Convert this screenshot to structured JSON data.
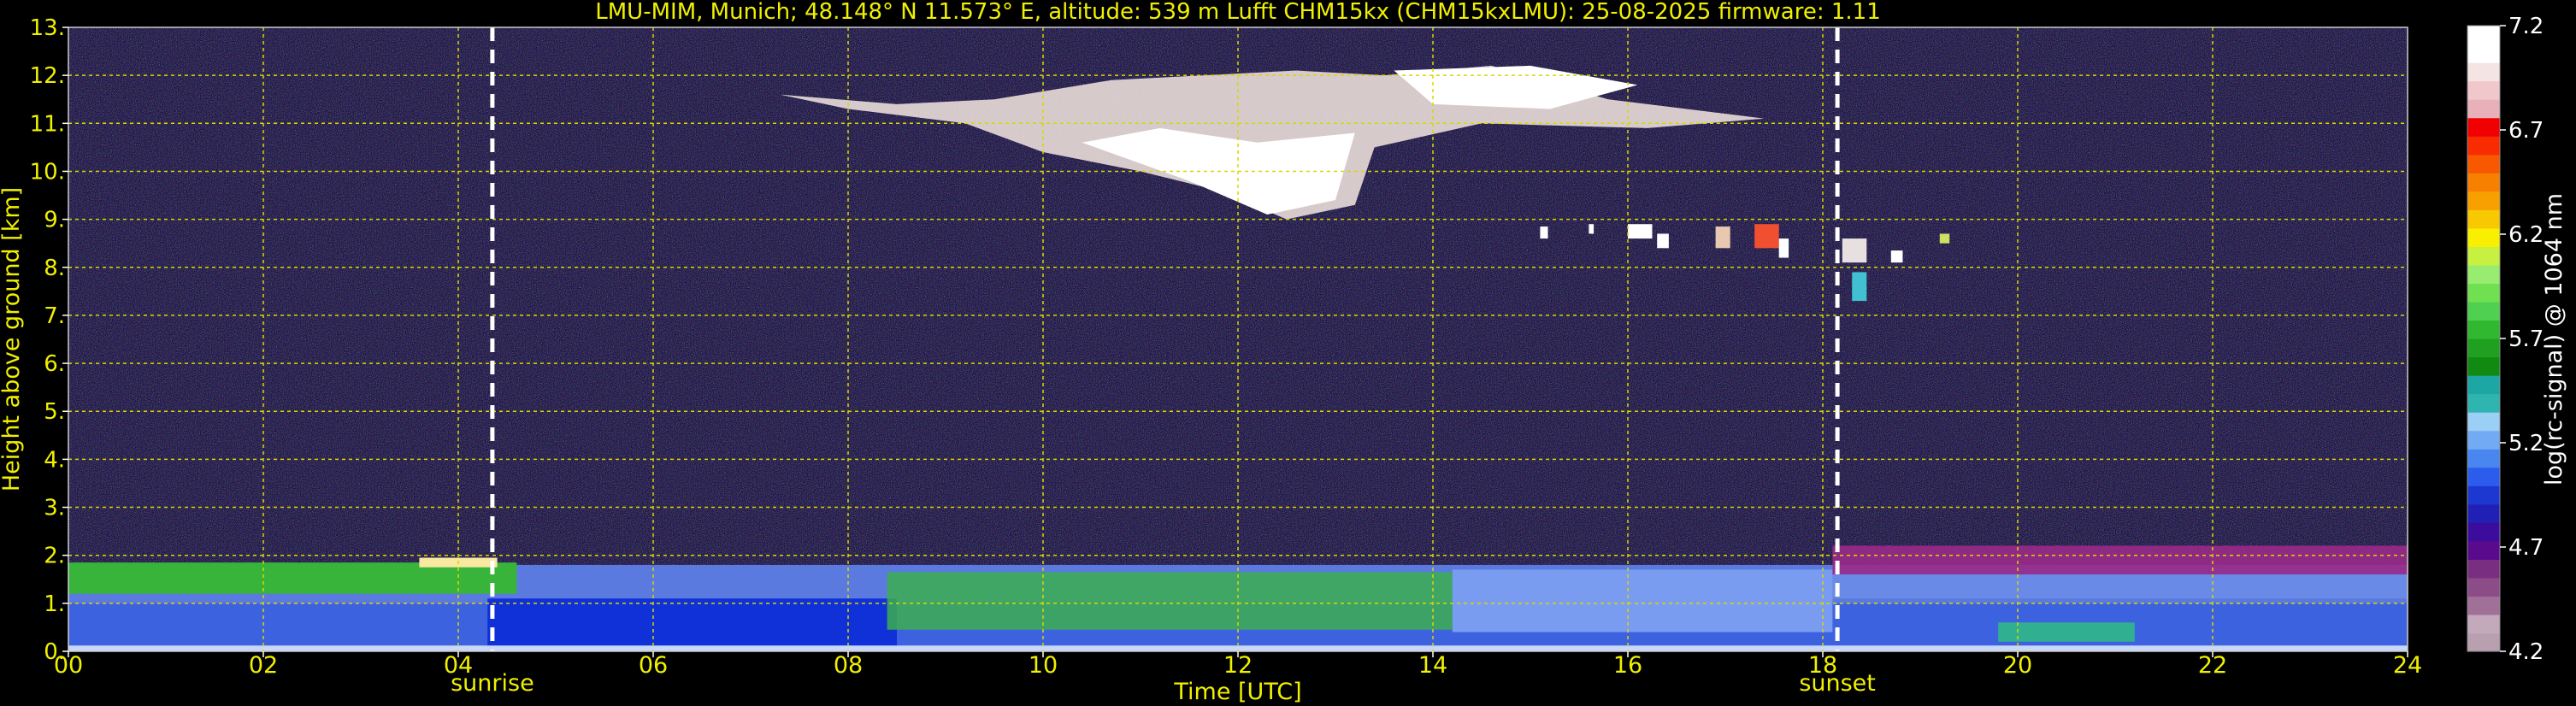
{
  "chart_data": {
    "type": "heatmap",
    "title": "LMU-MIM, Munich; 48.148° N 11.573° E, altitude: 539 m    Lufft CHM15kx (CHM15kxLMU): 25-08-2025    firmware: 1.11",
    "xlabel": "Time [UTC]",
    "ylabel": "Height above ground [km]",
    "xlim": [
      0,
      24
    ],
    "ylim": [
      0,
      13
    ],
    "x_ticks": [
      {
        "value": 0,
        "label": "00"
      },
      {
        "value": 2,
        "label": "02"
      },
      {
        "value": 4,
        "label": "04"
      },
      {
        "value": 6,
        "label": "06"
      },
      {
        "value": 8,
        "label": "08"
      },
      {
        "value": 10,
        "label": "10"
      },
      {
        "value": 12,
        "label": "12"
      },
      {
        "value": 14,
        "label": "14"
      },
      {
        "value": 16,
        "label": "16"
      },
      {
        "value": 18,
        "label": "18"
      },
      {
        "value": 20,
        "label": "20"
      },
      {
        "value": 22,
        "label": "22"
      },
      {
        "value": 24,
        "label": "24"
      }
    ],
    "y_ticks": [
      {
        "value": 0,
        "label": "0."
      },
      {
        "value": 1,
        "label": "1."
      },
      {
        "value": 2,
        "label": "2."
      },
      {
        "value": 3,
        "label": "3."
      },
      {
        "value": 4,
        "label": "4."
      },
      {
        "value": 5,
        "label": "5."
      },
      {
        "value": 6,
        "label": "6."
      },
      {
        "value": 7,
        "label": "7."
      },
      {
        "value": 8,
        "label": "8."
      },
      {
        "value": 9,
        "label": "9."
      },
      {
        "value": 10,
        "label": "10."
      },
      {
        "value": 11,
        "label": "11."
      },
      {
        "value": 12,
        "label": "12."
      },
      {
        "value": 13,
        "label": "13."
      }
    ],
    "grid": true,
    "markers": [
      {
        "label": "sunrise",
        "x": 4.35
      },
      {
        "label": "sunset",
        "x": 18.15
      }
    ],
    "colorbar": {
      "label": "log(rc-signal) @ 1064 nm",
      "range": [
        4.2,
        7.2
      ],
      "tick_labels": [
        {
          "value": 4.2,
          "label": "4.2"
        },
        {
          "value": 4.7,
          "label": "4.7"
        },
        {
          "value": 5.2,
          "label": "5.2"
        },
        {
          "value": 5.7,
          "label": "5.7"
        },
        {
          "value": 6.2,
          "label": "6.2"
        },
        {
          "value": 6.7,
          "label": "6.7"
        },
        {
          "value": 7.2,
          "label": "7.2"
        }
      ],
      "colors": [
        "#b8a0b0",
        "#c4a8bc",
        "#a07098",
        "#8c4c88",
        "#7a2e82",
        "#5a0a8c",
        "#3c0c9c",
        "#2020b4",
        "#1c38d0",
        "#2c5cec",
        "#4a86f0",
        "#72aaf4",
        "#9ccff6",
        "#30b4b0",
        "#1ca6a4",
        "#108a10",
        "#20a020",
        "#30b830",
        "#50d050",
        "#70e050",
        "#98ec70",
        "#c8f040",
        "#f8f000",
        "#f8c800",
        "#f8a000",
        "#f88000",
        "#f85800",
        "#f82c00",
        "#f00000",
        "#e8b0b8",
        "#f0c8cc",
        "#f4e4e4",
        "#ffffff",
        "#ffffff"
      ]
    },
    "features": [
      {
        "name": "boundary layer",
        "time_range": [
          0,
          24
        ],
        "height_range_km": [
          0,
          1.8
        ]
      },
      {
        "name": "cirrus cloud",
        "time_range": [
          7.5,
          17.5
        ],
        "height_range_km": [
          8.8,
          12.2
        ]
      },
      {
        "name": "mid-level cloud patches",
        "time_range": [
          15,
          19.3
        ],
        "height_range_km": [
          7,
          8.8
        ]
      }
    ]
  }
}
